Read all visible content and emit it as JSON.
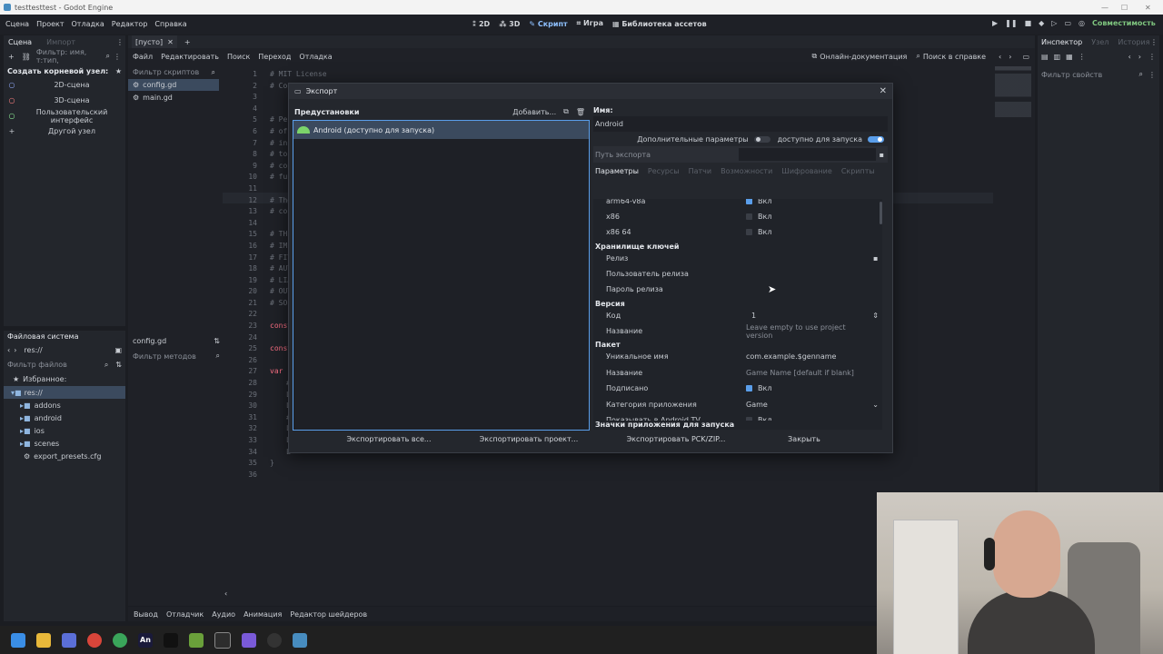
{
  "window": {
    "title": "testtesttest - Godot Engine"
  },
  "menubar": {
    "items": [
      "Сцена",
      "Проект",
      "Отладка",
      "Редактор",
      "Справка"
    ],
    "workspaces": [
      "2D",
      "3D",
      "Скрипт",
      "Игра",
      "Библиотека ассетов"
    ],
    "compat_label": "Совместимость"
  },
  "scene_dock": {
    "tabs": [
      "Сцена",
      "Импорт"
    ],
    "filter_placeholder": "Фильтр: имя, т:тип,",
    "create_root_label": "Создать корневой узел:",
    "root_options": [
      "2D-сцена",
      "3D-сцена",
      "Пользовательский интерфейс",
      "Другой узел"
    ]
  },
  "filesystem_dock": {
    "title": "Файловая система",
    "path": "res://",
    "filter_placeholder": "Фильтр файлов",
    "favorites_label": "Избранное:",
    "root": "res://",
    "items": [
      "addons",
      "android",
      "ios",
      "scenes",
      "export_presets.cfg"
    ]
  },
  "script_editor": {
    "tab_label": "[пусто]",
    "menu": [
      "Файл",
      "Редактировать",
      "Поиск",
      "Переход",
      "Отладка"
    ],
    "online_docs": "Онлайн-документация",
    "help_search": "Поиск в справке",
    "script_filter": "Фильтр скриптов",
    "scripts": [
      "config.gd",
      "main.gd"
    ],
    "current_script": "config.gd",
    "methods_filter": "Фильтр методов",
    "line_numbers": [
      "1",
      "2",
      "3",
      "4",
      "5",
      "6",
      "7",
      "8",
      "9",
      "10",
      "11",
      "12",
      "13",
      "14",
      "15",
      "16",
      "17",
      "18",
      "19",
      "20",
      "21",
      "22",
      "23",
      "24",
      "25",
      "26",
      "27",
      "28",
      "29",
      "30",
      "31",
      "32",
      "33",
      "34",
      "35",
      "36"
    ],
    "code_fragments": [
      "# MIT License",
      "# Cop",
      "# Per",
      "# of",
      "# in",
      "# to",
      "# cop",
      "# fur",
      "# The",
      "# cop",
      "# THE",
      "# IMP",
      "# FIT",
      "# AUT",
      "# LIA",
      "# OUT",
      "# SOF",
      "const",
      "const",
      "var L",
      "#",
      "L",
      "L",
      "#",
      "L",
      "L",
      "L",
      "}"
    ]
  },
  "bottom_panel": {
    "tabs": [
      "Вывод",
      "Отладчик",
      "Аудио",
      "Анимация",
      "Редактор шейдеров"
    ]
  },
  "inspector": {
    "tabs": [
      "Инспектор",
      "Узел",
      "История"
    ],
    "filter_placeholder": "Фильтр свойств"
  },
  "export_dialog": {
    "title": "Экспорт",
    "presets_label": "Предустановки",
    "add_label": "Добавить...",
    "presets": [
      {
        "name": "Android (доступно для запуска)"
      }
    ],
    "name_label": "Имя:",
    "name_value": "Android",
    "advanced_label": "Дополнительные параметры",
    "runnable_label": "доступно для запуска",
    "export_path_label": "Путь экспорта",
    "tabs": [
      "Параметры",
      "Ресурсы",
      "Патчи",
      "Возможности",
      "Шифрование",
      "Скрипты"
    ],
    "active_tab": "Параметры",
    "options_label": "Вкл",
    "arch": [
      {
        "name": "arm64-v8a",
        "on": true
      },
      {
        "name": "x86",
        "on": false
      },
      {
        "name": "x86 64",
        "on": false
      }
    ],
    "keystore": {
      "section": "Хранилище ключей",
      "release": "Релиз",
      "release_user": "Пользователь релиза",
      "release_password": "Пароль релиза"
    },
    "version": {
      "section": "Версия",
      "code_label": "Код",
      "code_value": "1",
      "name_label": "Название",
      "name_placeholder": "Leave empty to use project version"
    },
    "package": {
      "section": "Пакет",
      "unique_name_label": "Уникальное имя",
      "unique_name_value": "com.example.$genname",
      "name_label": "Название",
      "name_placeholder": "Game Name [default if blank]",
      "signed_label": "Подписано",
      "signed_on": true,
      "category_label": "Категория приложения",
      "category_value": "Game",
      "android_tv_label": "Показывать в Android TV",
      "android_tv_on": false
    },
    "launcher_icons_section": "Значки приложения для запуска",
    "buttons": {
      "export_all": "Экспортировать все...",
      "export_project": "Экспортировать проект...",
      "export_pck": "Экспортировать PCK/ZIP...",
      "close": "Закрыть"
    }
  },
  "colors": {
    "accent": "#5a9eea",
    "preset_selected": "#3b4a5e",
    "android_green": "#7bd46a"
  }
}
